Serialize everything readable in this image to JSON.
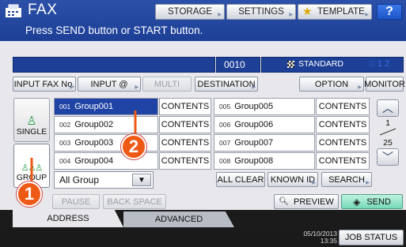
{
  "header": {
    "title": "FAX",
    "message": "Press SEND button or START button.",
    "storage_label": "STORAGE",
    "settings_label": "SETTINGS",
    "template_label": "TEMPLATE",
    "help_label": "?"
  },
  "status": {
    "count": "0010",
    "resolution": "STANDARD",
    "line_indicator": "1  2"
  },
  "toolbar": {
    "input_fax_no": "INPUT FAX No.",
    "input_at": "INPUT @",
    "multi": "MULTI",
    "destination": "DESTINATION",
    "option": "OPTION",
    "monitor": "MONITOR"
  },
  "side_tabs": {
    "single": "SINGLE",
    "group": "GROUP"
  },
  "groups": [
    {
      "num": "001",
      "name": "Group001",
      "action": "CONTENTS",
      "selected": true
    },
    {
      "num": "002",
      "name": "Group002",
      "action": "CONTENTS",
      "selected": false
    },
    {
      "num": "003",
      "name": "Group003",
      "action": "CONTENTS",
      "selected": false
    },
    {
      "num": "004",
      "name": "Group004",
      "action": "CONTENTS",
      "selected": false
    },
    {
      "num": "005",
      "name": "Group005",
      "action": "CONTENTS",
      "selected": false
    },
    {
      "num": "006",
      "name": "Group006",
      "action": "CONTENTS",
      "selected": false
    },
    {
      "num": "007",
      "name": "Group007",
      "action": "CONTENTS",
      "selected": false
    },
    {
      "num": "008",
      "name": "Group008",
      "action": "CONTENTS",
      "selected": false
    }
  ],
  "paging": {
    "current": "1",
    "total": "25"
  },
  "filter": {
    "selected": "All Group"
  },
  "actions": {
    "all_clear": "ALL CLEAR",
    "known_id": "KNOWN ID",
    "search": "SEARCH",
    "pause": "PAUSE",
    "back_space": "BACK SPACE",
    "preview": "PREVIEW",
    "send": "SEND"
  },
  "bottom_tabs": {
    "address": "ADDRESS",
    "advanced": "ADVANCED"
  },
  "footer": {
    "date": "05/10/2013",
    "time": "13:35",
    "job_status": "JOB STATUS"
  },
  "callouts": {
    "one": "1",
    "two": "2"
  },
  "colors": {
    "title_bar": "#1d3f96",
    "selected_row": "#1f44a5",
    "callout": "#ee5a16",
    "send": "#75d9b9"
  }
}
